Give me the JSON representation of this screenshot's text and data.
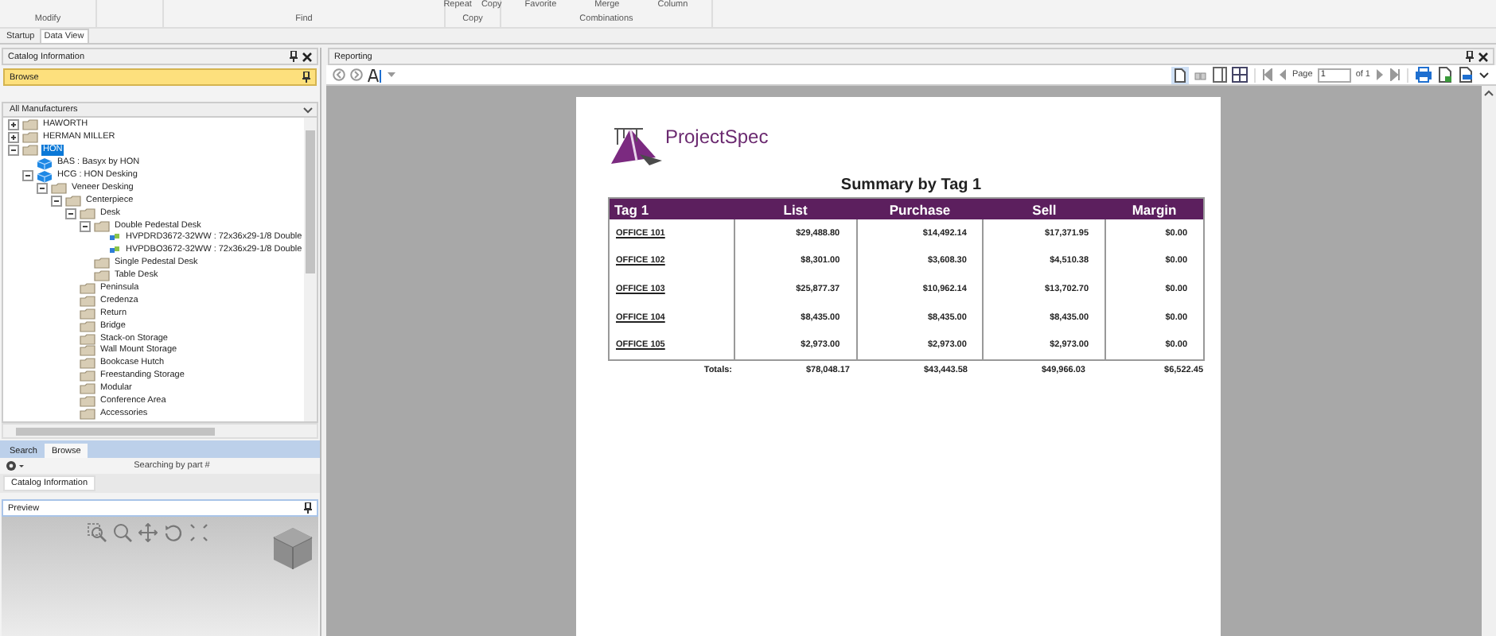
{
  "ribbon": {
    "groups": [
      {
        "label": "Modify"
      },
      {
        "label": "Find"
      },
      {
        "label": "Copy",
        "buttons": [
          "Repeat",
          "Copy"
        ]
      },
      {
        "label": "Combinations",
        "buttons": [
          "Favorite",
          "Merge",
          "Column"
        ]
      }
    ]
  },
  "doc_tabs": [
    {
      "label": "Startup",
      "selected": false
    },
    {
      "label": "Data View",
      "selected": true
    }
  ],
  "catalog_panel": {
    "title": "Catalog Information",
    "browse_bar": "Browse",
    "filter": "All Manufacturers",
    "tree": [
      {
        "label": "HAWORTH",
        "kind": "folder",
        "expanded": false,
        "selected": false
      },
      {
        "label": "HERMAN MILLER",
        "kind": "folder",
        "expanded": false,
        "selected": false
      },
      {
        "label": "HON",
        "kind": "folder",
        "expanded": true,
        "selected": true,
        "children": [
          {
            "label": "BAS : Basyx by HON",
            "kind": "catalog",
            "selected": false
          },
          {
            "label": "HCG : HON Desking",
            "kind": "catalog",
            "expanded": true,
            "selected": false,
            "children": [
              {
                "label": "Veneer Desking",
                "kind": "folder",
                "expanded": true,
                "selected": false,
                "children": [
                  {
                    "label": "Centerpiece",
                    "kind": "folder",
                    "expanded": true,
                    "selected": false,
                    "children": [
                      {
                        "label": "Desk",
                        "kind": "folder",
                        "expanded": true,
                        "selected": false,
                        "children": [
                          {
                            "label": "Double Pedestal Desk",
                            "kind": "folder",
                            "expanded": true,
                            "selected": false,
                            "children": [
                              {
                                "label": "HVPDRD3672-32WW : 72x36x29-1/8 Double",
                                "kind": "product",
                                "selected": false
                              },
                              {
                                "label": "HVPDBO3672-32WW : 72x36x29-1/8 Double",
                                "kind": "product",
                                "selected": false
                              }
                            ]
                          },
                          {
                            "label": "Single Pedestal Desk",
                            "kind": "folder",
                            "selected": false
                          },
                          {
                            "label": "Table Desk",
                            "kind": "folder",
                            "selected": false
                          }
                        ]
                      },
                      {
                        "label": "Peninsula",
                        "kind": "folder",
                        "selected": false
                      },
                      {
                        "label": "Credenza",
                        "kind": "folder",
                        "selected": false
                      },
                      {
                        "label": "Return",
                        "kind": "folder",
                        "selected": false
                      },
                      {
                        "label": "Bridge",
                        "kind": "folder",
                        "selected": false
                      },
                      {
                        "label": "Stack-on Storage",
                        "kind": "folder",
                        "selected": false
                      },
                      {
                        "label": "Wall Mount Storage",
                        "kind": "folder",
                        "selected": false
                      },
                      {
                        "label": "Bookcase Hutch",
                        "kind": "folder",
                        "selected": false
                      },
                      {
                        "label": "Freestanding Storage",
                        "kind": "folder",
                        "selected": false
                      },
                      {
                        "label": "Modular",
                        "kind": "folder",
                        "selected": false
                      },
                      {
                        "label": "Conference Area",
                        "kind": "folder",
                        "selected": false
                      },
                      {
                        "label": "Accessories",
                        "kind": "folder",
                        "selected": false
                      }
                    ]
                  }
                ]
              }
            ]
          }
        ]
      }
    ],
    "bottom_tabs": [
      {
        "label": "Search",
        "selected": false
      },
      {
        "label": "Browse",
        "selected": true
      }
    ],
    "search_status": "Searching by part #",
    "tooltip": "Catalog Information"
  },
  "preview_panel": {
    "title": "Preview"
  },
  "reporting_panel": {
    "title": "Reporting",
    "page_label": "Page",
    "page_value": "1",
    "page_of": "of 1",
    "report": {
      "logo_text": "ProjectSpec",
      "title": "Summary by Tag 1",
      "columns": [
        "Tag 1",
        "List",
        "Purchase",
        "Sell",
        "Margin"
      ],
      "rows": [
        [
          "OFFICE 101",
          "$29,488.80",
          "$14,492.14",
          "$17,371.95",
          "$0.00"
        ],
        [
          "OFFICE 102",
          "$8,301.00",
          "$3,608.30",
          "$4,510.38",
          "$0.00"
        ],
        [
          "OFFICE 103",
          "$25,877.37",
          "$10,962.14",
          "$13,702.70",
          "$0.00"
        ],
        [
          "OFFICE 104",
          "$8,435.00",
          "$8,435.00",
          "$8,435.00",
          "$0.00"
        ],
        [
          "OFFICE 105",
          "$2,973.00",
          "$2,973.00",
          "$2,973.00",
          "$0.00"
        ]
      ],
      "totals_label": "Totals:",
      "totals": [
        "$78,048.17",
        "$43,443.58",
        "$49,966.03",
        "$6,522.45"
      ]
    }
  }
}
